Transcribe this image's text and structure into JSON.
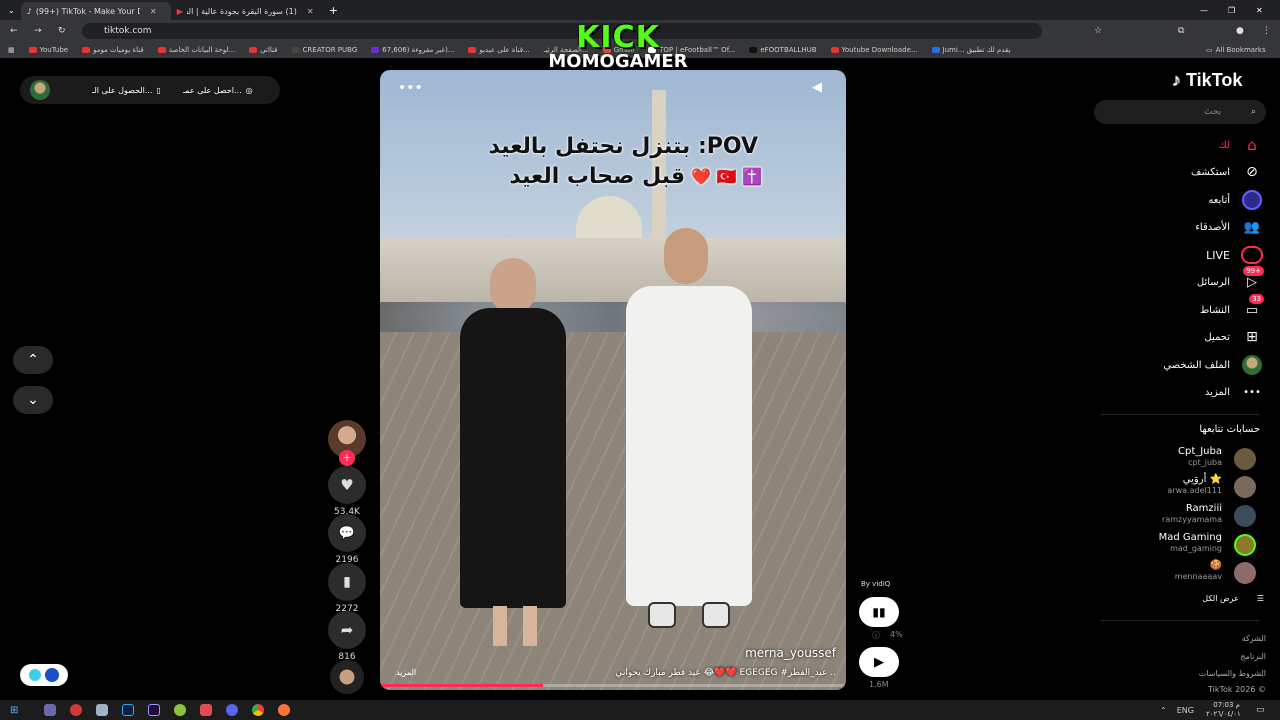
{
  "browser": {
    "tabs": [
      {
        "label": "(99+) TikTok - Make Your Da...",
        "active": true
      },
      {
        "label": "(1) سورة البقرة بجودة عالية | الش...",
        "active": false
      }
    ],
    "url": "tiktok.com",
    "bookmarks": [
      "YouTube",
      "قناة يوميات مومو",
      "لوحة البيانات الخاصة...",
      "قنااتي",
      "CREATOR PUBG",
      "67,606) غير مقروءة)...",
      "قناة على عيديو...",
      "الصفحة الرئيـ...",
      "Gmail",
      "TOP | eFootball™ Of...",
      "eFOOTBALLHUB",
      "Youtube Downloade...",
      "Jumi... يقدم لك تطبيق",
      "All Bookmarks"
    ]
  },
  "overlay": {
    "kick": "KICK",
    "streamer": "MOMOGAMER"
  },
  "top_actions": {
    "get_app": "احصل على عمـ...",
    "get_coins": "الحصول على الـ..."
  },
  "video": {
    "overlay_line1": "بتنزل نحتفل بالعيد :POV",
    "overlay_line2": "قبل صحاب العيد",
    "author": "merna_youssef",
    "caption": "عيد فطر مبارك يحواتي 😂❤️❤️ EGEGEG #عيد_الفطر ..",
    "more": "المزيد",
    "progress": 0.35
  },
  "actions": {
    "likes": "53.4K",
    "comments": "2196",
    "saves": "2272",
    "shares": "816"
  },
  "vidiq": {
    "label": "By vidIQ",
    "percent": "4%",
    "views": "1.6M"
  },
  "sidebar": {
    "logo": "TikTok",
    "search_placeholder": "بحث",
    "nav": [
      {
        "label": "لك",
        "icon": "home-icon"
      },
      {
        "label": "استكشف",
        "icon": "compass-icon"
      },
      {
        "label": "أتابعه",
        "icon": "following-icon"
      },
      {
        "label": "الأصدقاء",
        "icon": "friends-icon"
      },
      {
        "label": "LIVE",
        "icon": "live-icon"
      },
      {
        "label": "الرسائل",
        "icon": "messages-icon",
        "badge": "99+"
      },
      {
        "label": "النشاط",
        "icon": "activity-icon",
        "badge": "33"
      },
      {
        "label": "تحميل",
        "icon": "upload-icon"
      },
      {
        "label": "الملف الشخصي",
        "icon": "profile-icon"
      },
      {
        "label": "المزيد",
        "icon": "more-icon"
      }
    ],
    "following_title": "حسابات تتابعها",
    "accounts": [
      {
        "name": "Cpt_Juba",
        "user": "cpt_juba"
      },
      {
        "name": "أروَيي ⭐",
        "user": "arwa.adel111"
      },
      {
        "name": "Ramziii",
        "user": "ramzyyamama"
      },
      {
        "name": "Mad Gaming",
        "user": "mad_gaming"
      },
      {
        "name": "🍪",
        "user": "mennaaaav"
      }
    ],
    "see_all": "عرض الكل",
    "footer": [
      "الشركة",
      "البرنامج",
      "الشروط والسياسات",
      "TikTok 2026 ©"
    ]
  },
  "taskbar": {
    "time": "07:03 م",
    "date": "٢٠٢٦/٠٤/٠١"
  },
  "colors": {
    "brand": "#fe2c55",
    "kick": "#53fc18"
  }
}
